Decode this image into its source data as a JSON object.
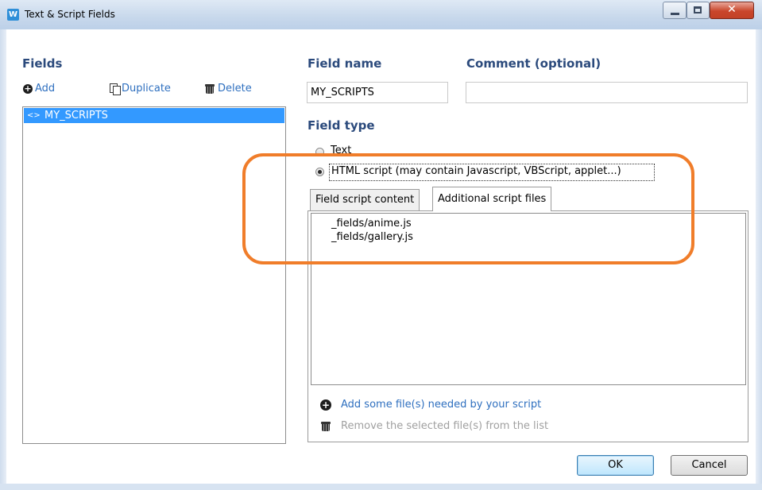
{
  "window": {
    "title": "Text & Script Fields",
    "app_icon_letter": "W"
  },
  "fields_panel": {
    "heading": "Fields",
    "toolbar": {
      "add_label": "Add",
      "duplicate_label": "Duplicate",
      "delete_label": "Delete"
    },
    "items": [
      {
        "label": "MY_SCRIPTS",
        "selected": true
      }
    ]
  },
  "field_name": {
    "heading": "Field name",
    "value": "MY_SCRIPTS"
  },
  "comment": {
    "heading": "Comment (optional)",
    "value": ""
  },
  "field_type": {
    "heading": "Field type",
    "options": [
      {
        "label": "Text",
        "checked": false
      },
      {
        "label": "HTML script (may contain Javascript, VBScript, applet...)",
        "checked": true
      }
    ]
  },
  "tabs": [
    {
      "label": "Field script content",
      "active": false
    },
    {
      "label": "Additional script files",
      "active": true
    }
  ],
  "script_files": [
    "_fields/anime.js",
    "_fields/gallery.js"
  ],
  "actions": {
    "add_files": "Add some file(s) needed by your script",
    "remove_files": "Remove the selected file(s) from the list"
  },
  "buttons": {
    "ok": "OK",
    "cancel": "Cancel"
  },
  "colors": {
    "accent": "#2b4a7c",
    "link": "#2e6fbf",
    "selection": "#3399ff",
    "annotation": "#f07d2a"
  }
}
